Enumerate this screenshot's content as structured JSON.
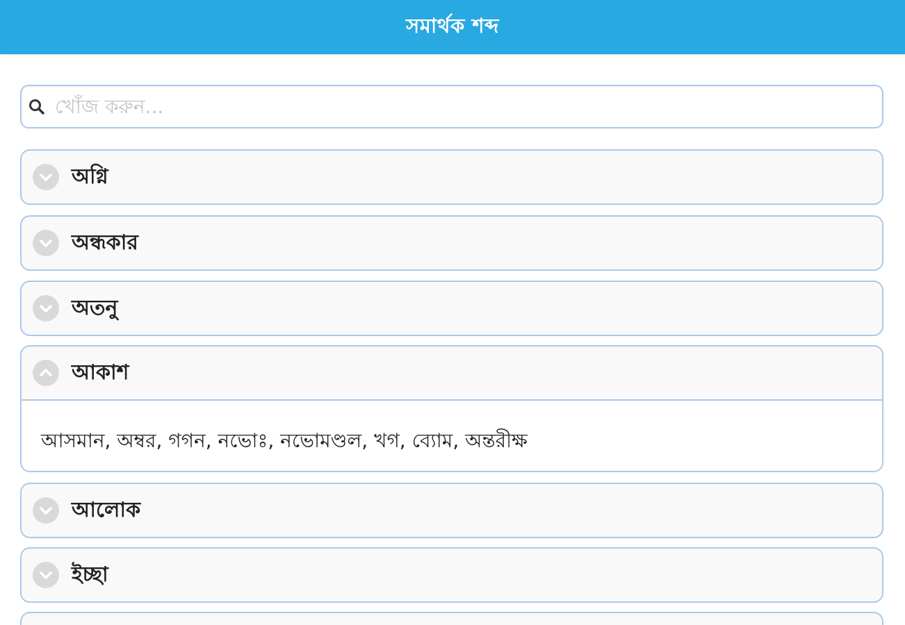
{
  "header": {
    "title": "সমার্থক শব্দ"
  },
  "search": {
    "placeholder": "খোঁজ করুন...",
    "value": ""
  },
  "items": [
    {
      "title": "অগ্নি",
      "expanded": false
    },
    {
      "title": "অন্ধকার",
      "expanded": false
    },
    {
      "title": "অতনু",
      "expanded": false
    },
    {
      "title": "আকাশ",
      "expanded": true,
      "content": "আসমান, অম্বর, গগন, নভোঃ, নভোমণ্ডল, খগ, ব্যোম, অন্তরীক্ষ"
    },
    {
      "title": "আলোক",
      "expanded": false
    },
    {
      "title": "ইচ্ছা",
      "expanded": false
    }
  ],
  "icons": {
    "collapsed": "chevron-down-icon",
    "expanded": "chevron-up-icon",
    "search": "search-icon"
  },
  "colors": {
    "header": "#29a9e1",
    "border": "#a9c9ec",
    "chevron_bg": "#d9d9d9"
  }
}
